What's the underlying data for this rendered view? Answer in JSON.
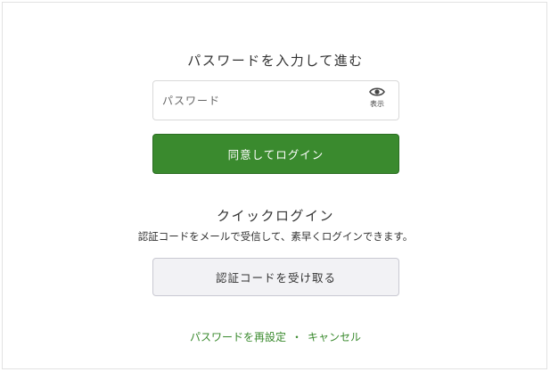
{
  "password_section": {
    "title": "パスワードを入力して進む",
    "input_placeholder": "パスワード",
    "input_value": "",
    "show_toggle_label": "表示",
    "show_toggle_icon": "eye-icon",
    "submit_label": "同意してログイン"
  },
  "quick_login": {
    "title": "クイックログイン",
    "description": "認証コードをメールで受信して、素早くログインできます。",
    "button_label": "認証コードを受け取る"
  },
  "footer": {
    "reset_password_label": "パスワードを再設定",
    "separator": "・",
    "cancel_label": "キャンセル"
  },
  "colors": {
    "primary": "#3a8a2e",
    "secondary_button_bg": "#f2f2f5",
    "link": "#3a8a2e"
  }
}
